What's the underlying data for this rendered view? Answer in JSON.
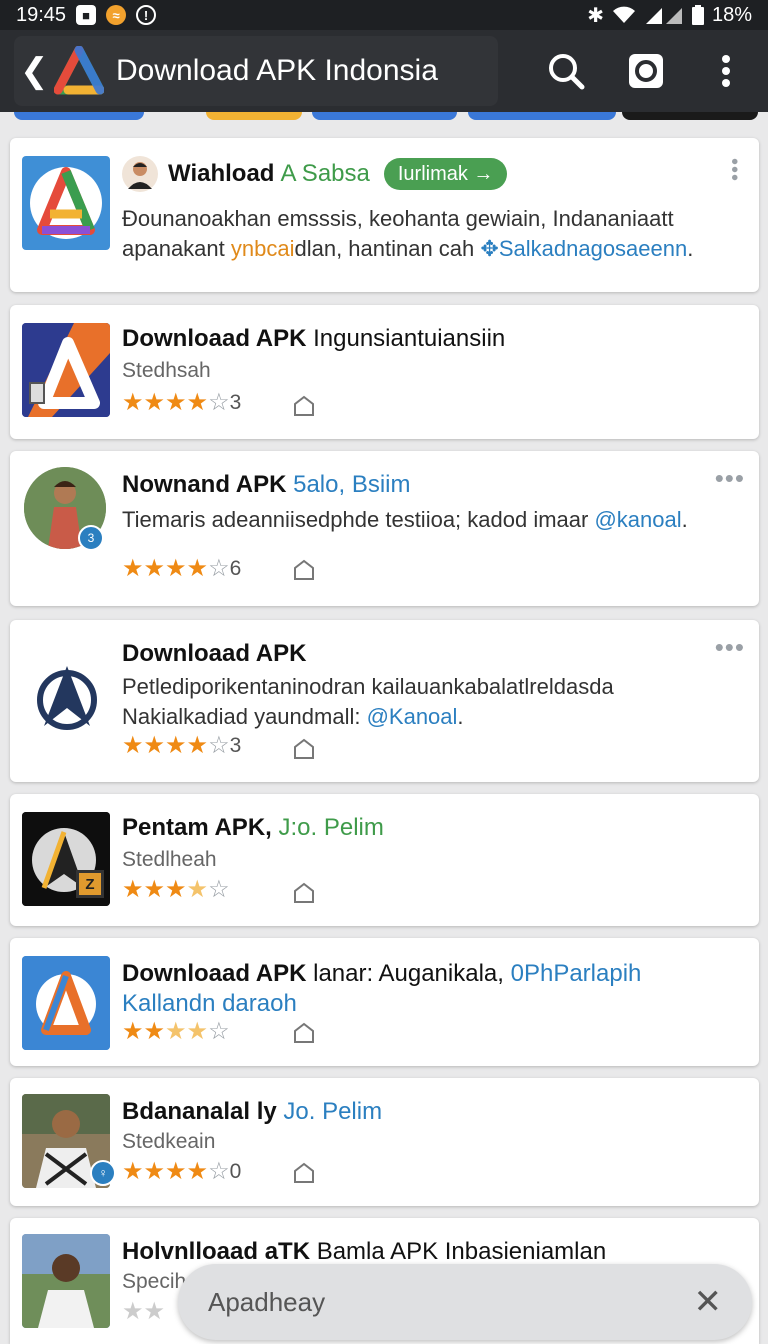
{
  "status_bar": {
    "time": "19:45",
    "battery": "18%"
  },
  "app_bar": {
    "title": "Download APK Indonsia"
  },
  "cards": [
    {
      "title": "Wiahload",
      "title_green": "A Sabsa",
      "tag": "Iurlimak →",
      "desc_line1": "Ɖounanoakhan emsssis, keohanta gewiain, Indananiaatt",
      "desc_line2_a": "apanakant ",
      "desc_line2_orange": "ynbcai",
      "desc_line2_b": "dlan, hantinan cah ",
      "desc_line2_link": "✥Salkadnagosaeenn",
      "desc_line2_end": "."
    },
    {
      "title": "Downloaad APK ",
      "title_plain": "Ingunsiantuiansiin",
      "sub": "Stedhsah",
      "count": "3"
    },
    {
      "title": "Nownand APK ",
      "title_blue": "5alo, Bsiim",
      "desc_a": "Tiemaris adeanniisedphde testiioa; kadod imaar ",
      "desc_link": "@kanoal",
      "desc_end": ".",
      "count": "6",
      "badge": "3"
    },
    {
      "title": "Downloaad APK",
      "desc_line1": "Petlediporikentaninodran kailauankabalatlreldasda",
      "desc_line2_a": "Nakialkadiad yaundmall: ",
      "desc_line2_link": "@Kanoal",
      "desc_line2_end": ".",
      "count": "3"
    },
    {
      "title": "Pentam APK, ",
      "title_green": "J:o. Pelim",
      "sub": "Stedlheah",
      "thumb_badge": "Z"
    },
    {
      "title": "Downloaad APK ",
      "title_plain": "lanar: Auganikala, ",
      "title_blue": "0PhParlapih",
      "title_line2": "Kallandn daraoh"
    },
    {
      "title": "Bdananalal ly ",
      "title_blue": "Jo. Pelim",
      "sub": "Stedkeain",
      "count": "0",
      "badge": "♀"
    },
    {
      "title": "Holvnlloaad aTK ",
      "title_plain": "Bamla APK  Inbasieniamlan",
      "sub": "Specih"
    }
  ],
  "snackbar": {
    "text": "Apadheay"
  },
  "colors": {
    "star_on": "#ef8a14",
    "link_blue": "#2b7fc0",
    "accent_green": "#4a9f52",
    "app_bar": "#2b2d31"
  }
}
